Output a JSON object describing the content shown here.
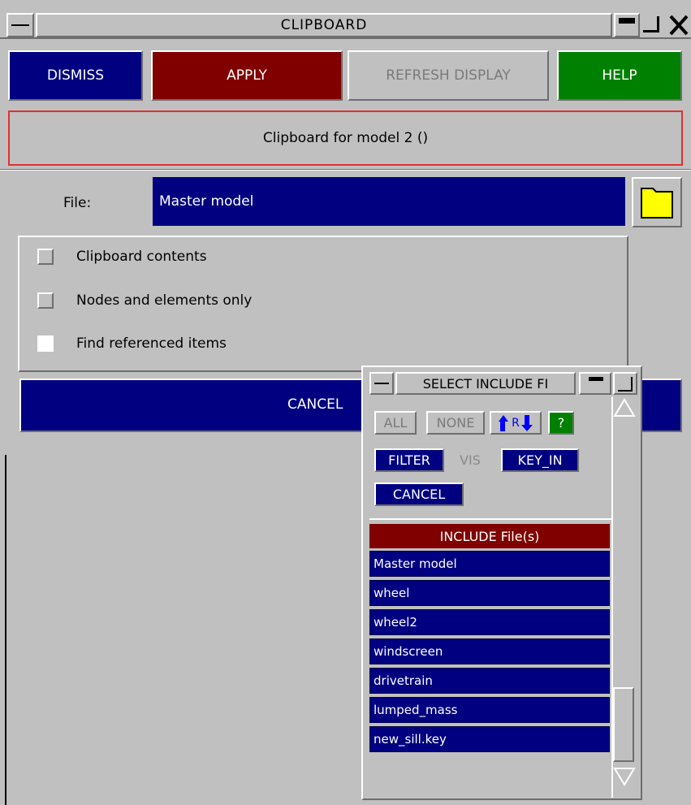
{
  "window": {
    "title": "CLIPBOARD"
  },
  "toolbar": {
    "dismiss": "DISMISS",
    "apply": "APPLY",
    "refresh": "REFRESH DISPLAY",
    "help": "HELP"
  },
  "banner": "Clipboard for model 2 ()",
  "file": {
    "label": "File:",
    "value": "Master model"
  },
  "options": [
    {
      "label": "Clipboard contents",
      "checked": false
    },
    {
      "label": "Nodes and elements only",
      "checked": false
    },
    {
      "label": "Find referenced items",
      "checked": false
    }
  ],
  "cancel_label": "CANCEL",
  "popup": {
    "title": "SELECT INCLUDE FI",
    "buttons": {
      "all": "ALL",
      "none": "NONE",
      "reverse": "R",
      "help": "?",
      "filter": "FILTER",
      "vis": "VIS",
      "key_in": "KEY_IN",
      "cancel": "CANCEL"
    },
    "list_header": "INCLUDE File(s)",
    "items": [
      "Master model",
      "wheel",
      "wheel2",
      "windscreen",
      "drivetrain",
      "lumped_mass",
      "new_sill.key"
    ]
  },
  "colors": {
    "navy": "#000080",
    "maroon": "#800000",
    "green": "#008000",
    "panel": "#c0c0c0"
  }
}
